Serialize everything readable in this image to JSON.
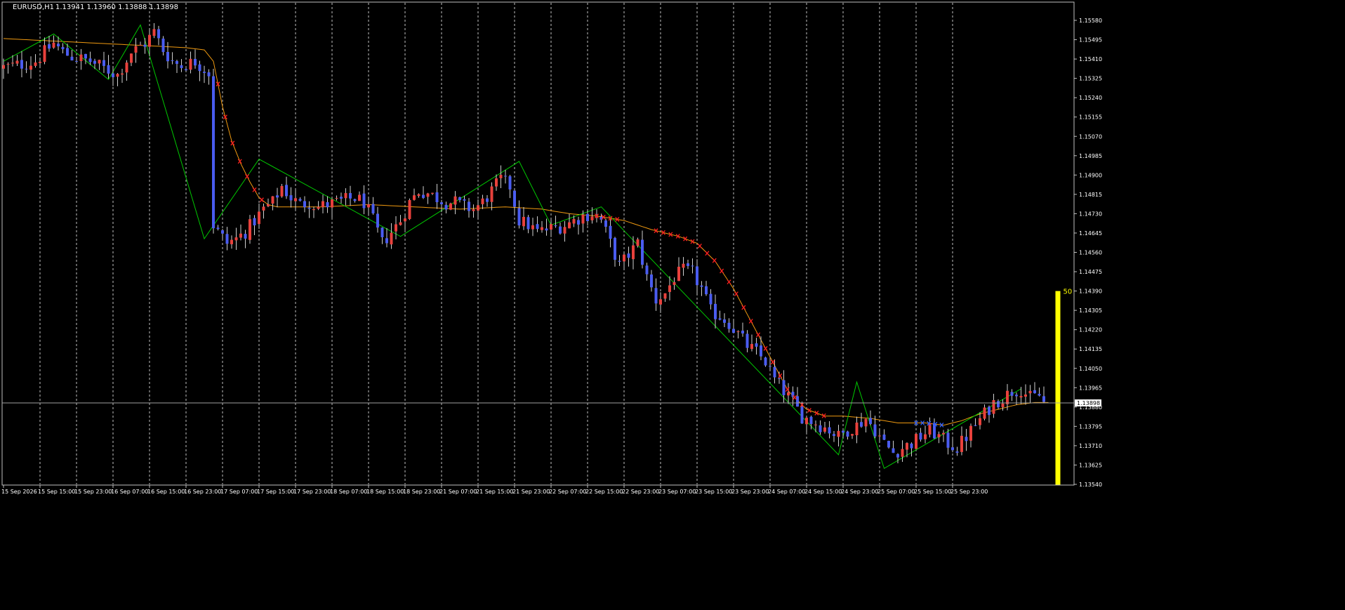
{
  "header": {
    "symbol": "EURUSD,H1",
    "ohlc": "1.13941 1.13960 1.13888 1.13898"
  },
  "colors": {
    "background": "#000000",
    "frame": "#c0c0c0",
    "grid": "#c0c0c0",
    "text": "#ffffff",
    "bull_candle": "#e8413c",
    "bear_candle": "#4a5cf0",
    "wick": "#d0d0d0",
    "zigzag": "#00c800",
    "moving_average": "#f09a10",
    "trend_arrows_down": "#ff2020",
    "trend_arrows_up": "#3060ff",
    "volume_bar": "#ffff00",
    "bid_line": "#a0a0a0"
  },
  "chart_data": {
    "type": "candlestick",
    "symbol": "EURUSD",
    "timeframe": "H1",
    "ylim": [
      1.1358,
      1.1562
    ],
    "y_ticks": [
      "1.15580",
      "1.15495",
      "1.15410",
      "1.15325",
      "1.15240",
      "1.15155",
      "1.15070",
      "1.14985",
      "1.14900",
      "1.14815",
      "1.14730",
      "1.14645",
      "1.14560",
      "1.14475",
      "1.14390",
      "1.14305",
      "1.14220",
      "1.14135",
      "1.14050",
      "1.13965",
      "1.13880",
      "1.13795",
      "1.13710",
      "1.13625",
      "1.13540"
    ],
    "x_ticks": [
      "15 Sep 2026",
      "15 Sep 15:00",
      "15 Sep 23:00",
      "16 Sep 07:00",
      "16 Sep 15:00",
      "16 Sep 23:00",
      "17 Sep 07:00",
      "17 Sep 15:00",
      "17 Sep 23:00",
      "18 Sep 07:00",
      "18 Sep 15:00",
      "18 Sep 23:00",
      "21 Sep 07:00",
      "21 Sep 15:00",
      "21 Sep 23:00",
      "22 Sep 07:00",
      "22 Sep 15:00",
      "22 Sep 23:00",
      "23 Sep 07:00",
      "23 Sep 15:00",
      "23 Sep 23:00",
      "24 Sep 07:00",
      "24 Sep 15:00",
      "24 Sep 23:00",
      "25 Sep 07:00",
      "25 Sep 15:00",
      "25 Sep 23:00"
    ],
    "current_price": "1.13898",
    "volume_label": "50",
    "close_path": [
      [
        0,
        1.1537
      ],
      [
        6,
        1.1539
      ],
      [
        8,
        1.154
      ],
      [
        12,
        1.1548
      ],
      [
        14,
        1.1544
      ],
      [
        16,
        1.1542
      ],
      [
        20,
        1.154
      ],
      [
        22,
        1.1538
      ],
      [
        26,
        1.1534
      ],
      [
        29,
        1.1544
      ],
      [
        32,
        1.1548
      ],
      [
        34,
        1.1553
      ],
      [
        36,
        1.1545
      ],
      [
        38,
        1.154
      ],
      [
        40,
        1.1538
      ],
      [
        43,
        1.154
      ],
      [
        46,
        1.1535
      ],
      [
        47,
        1.1468
      ],
      [
        48,
        1.1465
      ],
      [
        50,
        1.146
      ],
      [
        52,
        1.1462
      ],
      [
        54,
        1.1465
      ],
      [
        56,
        1.147
      ],
      [
        58,
        1.1475
      ],
      [
        60,
        1.1478
      ],
      [
        62,
        1.1485
      ],
      [
        64,
        1.148
      ],
      [
        66,
        1.1477
      ],
      [
        68,
        1.1478
      ],
      [
        70,
        1.1476
      ],
      [
        72,
        1.1477
      ],
      [
        74,
        1.1478
      ],
      [
        76,
        1.1479
      ],
      [
        78,
        1.148
      ],
      [
        80,
        1.1478
      ],
      [
        82,
        1.147
      ],
      [
        84,
        1.146
      ],
      [
        86,
        1.1465
      ],
      [
        88,
        1.147
      ],
      [
        90,
        1.1478
      ],
      [
        92,
        1.1483
      ],
      [
        94,
        1.1482
      ],
      [
        96,
        1.148
      ],
      [
        98,
        1.1478
      ],
      [
        100,
        1.1478
      ],
      [
        102,
        1.1476
      ],
      [
        104,
        1.1475
      ],
      [
        106,
        1.1478
      ],
      [
        108,
        1.1483
      ],
      [
        110,
        1.1488
      ],
      [
        112,
        1.1485
      ],
      [
        114,
        1.147
      ],
      [
        116,
        1.1468
      ],
      [
        118,
        1.1465
      ],
      [
        120,
        1.1466
      ],
      [
        122,
        1.1467
      ],
      [
        124,
        1.1468
      ],
      [
        126,
        1.147
      ],
      [
        128,
        1.1472
      ],
      [
        130,
        1.1473
      ],
      [
        132,
        1.147
      ],
      [
        134,
        1.146
      ],
      [
        136,
        1.145
      ],
      [
        138,
        1.1455
      ],
      [
        140,
        1.146
      ],
      [
        142,
        1.1445
      ],
      [
        144,
        1.1435
      ],
      [
        146,
        1.1438
      ],
      [
        148,
        1.1445
      ],
      [
        150,
        1.1448
      ],
      [
        152,
        1.1447
      ],
      [
        154,
        1.144
      ],
      [
        156,
        1.143
      ],
      [
        158,
        1.1428
      ],
      [
        160,
        1.1425
      ],
      [
        162,
        1.142
      ],
      [
        164,
        1.1415
      ],
      [
        166,
        1.1412
      ],
      [
        168,
        1.1408
      ],
      [
        170,
        1.14
      ],
      [
        172,
        1.1395
      ],
      [
        174,
        1.139
      ],
      [
        176,
        1.1384
      ],
      [
        178,
        1.1382
      ],
      [
        180,
        1.138
      ],
      [
        182,
        1.1378
      ],
      [
        184,
        1.1375
      ],
      [
        186,
        1.1378
      ],
      [
        188,
        1.138
      ],
      [
        190,
        1.1383
      ],
      [
        192,
        1.1378
      ],
      [
        194,
        1.1372
      ],
      [
        196,
        1.1368
      ],
      [
        198,
        1.137
      ],
      [
        200,
        1.1372
      ],
      [
        202,
        1.1375
      ],
      [
        204,
        1.1378
      ],
      [
        206,
        1.1375
      ],
      [
        208,
        1.1372
      ],
      [
        210,
        1.137
      ],
      [
        212,
        1.1375
      ],
      [
        214,
        1.138
      ],
      [
        216,
        1.1385
      ],
      [
        218,
        1.139
      ],
      [
        220,
        1.1392
      ],
      [
        222,
        1.1395
      ],
      [
        224,
        1.1396
      ],
      [
        226,
        1.1392
      ],
      [
        228,
        1.1393
      ],
      [
        229,
        1.13898
      ]
    ],
    "moving_average": [
      [
        0,
        1.155
      ],
      [
        20,
        1.1548
      ],
      [
        40,
        1.1546
      ],
      [
        44,
        1.1545
      ],
      [
        46,
        1.154
      ],
      [
        48,
        1.152
      ],
      [
        50,
        1.1505
      ],
      [
        52,
        1.1495
      ],
      [
        54,
        1.1487
      ],
      [
        56,
        1.148
      ],
      [
        58,
        1.1477
      ],
      [
        60,
        1.1476
      ],
      [
        70,
        1.1476
      ],
      [
        80,
        1.1477
      ],
      [
        90,
        1.1476
      ],
      [
        100,
        1.1475
      ],
      [
        110,
        1.1476
      ],
      [
        118,
        1.1475
      ],
      [
        124,
        1.1473
      ],
      [
        130,
        1.1472
      ],
      [
        136,
        1.147
      ],
      [
        142,
        1.1466
      ],
      [
        148,
        1.1463
      ],
      [
        152,
        1.146
      ],
      [
        156,
        1.1452
      ],
      [
        160,
        1.144
      ],
      [
        164,
        1.1425
      ],
      [
        168,
        1.141
      ],
      [
        172,
        1.1395
      ],
      [
        176,
        1.1387
      ],
      [
        180,
        1.1384
      ],
      [
        184,
        1.1384
      ],
      [
        190,
        1.1383
      ],
      [
        196,
        1.1381
      ],
      [
        202,
        1.1381
      ],
      [
        206,
        1.138
      ],
      [
        210,
        1.1382
      ],
      [
        214,
        1.1385
      ],
      [
        218,
        1.1387
      ],
      [
        222,
        1.1389
      ],
      [
        226,
        1.139
      ],
      [
        229,
        1.139
      ]
    ],
    "zigzag": [
      [
        0,
        1.154
      ],
      [
        11,
        1.1552
      ],
      [
        23,
        1.1532
      ],
      [
        30,
        1.1556
      ],
      [
        44,
        1.1462
      ],
      [
        56,
        1.1497
      ],
      [
        87,
        1.1463
      ],
      [
        113,
        1.1496
      ],
      [
        120,
        1.1468
      ],
      [
        131,
        1.1476
      ],
      [
        183,
        1.1367
      ],
      [
        187,
        1.1399
      ],
      [
        193,
        1.1361
      ],
      [
        223,
        1.1396
      ]
    ]
  }
}
